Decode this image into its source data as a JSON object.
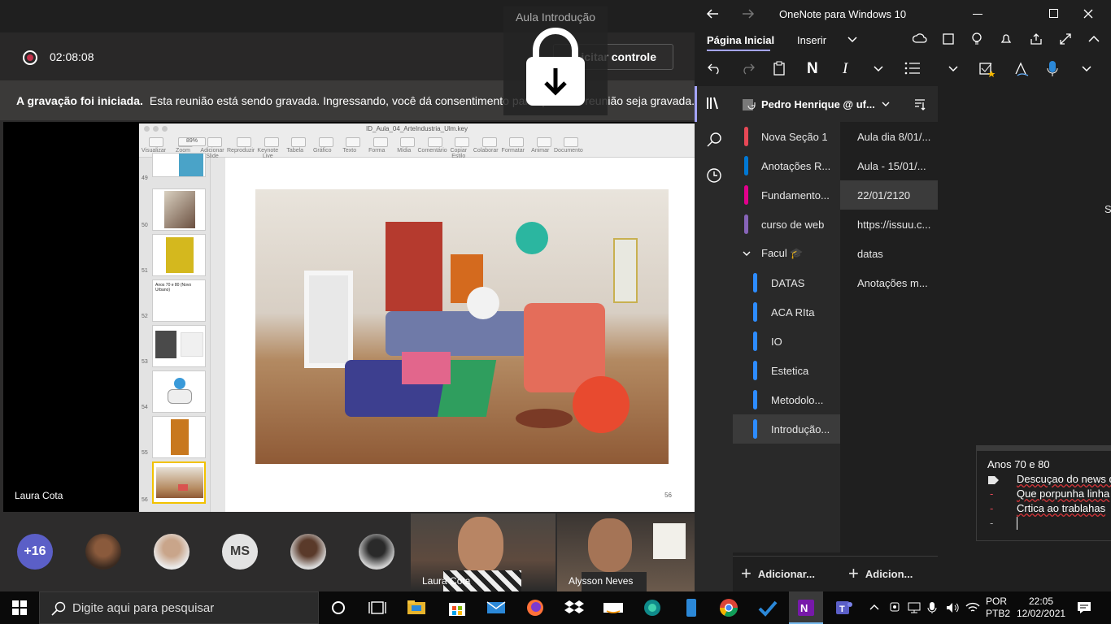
{
  "teams": {
    "recording_time": "02:08:08",
    "control_button": "icitar controle",
    "banner_bold": "A gravação foi iniciada.",
    "banner_text": "Esta reunião está sendo gravada. Ingressando, você dá consentimento para que esta reunião seja gravada.",
    "video_name": "Laura Cota",
    "overflow_count": "+16",
    "ms_initials": "MS",
    "tile1_name": "Laura Cota",
    "tile2_name": "Alysson Neves",
    "lock_title": "Aula Introdução"
  },
  "keynote": {
    "file_title": "ID_Aula_04_ArteIndustria_Ulm.key",
    "toolbar": [
      "Visualizar",
      "Zoom",
      "Adicionar Slide",
      "Reproduzir",
      "Keynote Live",
      "Tabela",
      "Gráfico",
      "Texto",
      "Forma",
      "Mídia",
      "Comentário",
      "Copiar Estilo",
      "Colaborar",
      "Formatar",
      "Animar",
      "Documento"
    ],
    "zoom": "89%",
    "thumb_numbers": [
      "49",
      "50",
      "51",
      "52",
      "53",
      "54",
      "55",
      "56"
    ],
    "thumb52_title": "Anos 70 e 80 (Novo Urbano)",
    "slide_number": "56"
  },
  "onenote": {
    "app_title": "OneNote para Windows 10",
    "tab_home": "Página Inicial",
    "tab_insert": "Inserir",
    "notebook_name": "Pedro Henrique @ uf...",
    "sections": [
      {
        "label": "Nova Seção 1",
        "color": "#e74856"
      },
      {
        "label": "Anotações R...",
        "color": "#0078d4"
      },
      {
        "label": "Fundamento...",
        "color": "#e3008c"
      },
      {
        "label": "curso de web",
        "color": "#8764b8"
      }
    ],
    "group": "Facul 🎓",
    "group_sections": [
      {
        "label": "DATAS",
        "color": "#2d8cff"
      },
      {
        "label": "ACA RIta",
        "color": "#2d8cff"
      },
      {
        "label": "IO",
        "color": "#2d8cff"
      },
      {
        "label": "Estetica",
        "color": "#2d8cff"
      },
      {
        "label": "Metodolo...",
        "color": "#2d8cff"
      },
      {
        "label": "Introdução...",
        "color": "#2d8cff"
      }
    ],
    "pages": [
      "Aula dia 8/01/...",
      "Aula - 15/01/...",
      "22/01/2120",
      "https://issuu.c...",
      "datas",
      "Anotações m..."
    ],
    "add_section": "Adicionar...",
    "add_page": "Adicion...",
    "edge_letter": "S",
    "note_title": "Anos 70 e 80",
    "note_lines": [
      "Descuçao do news d",
      "Que porpunha linha",
      "Crtica ao trablahas"
    ]
  },
  "taskbar": {
    "search_placeholder": "Digite aqui para pesquisar",
    "lang1": "POR",
    "lang2": "PTB2",
    "time": "22:05",
    "date": "12/02/2021"
  }
}
